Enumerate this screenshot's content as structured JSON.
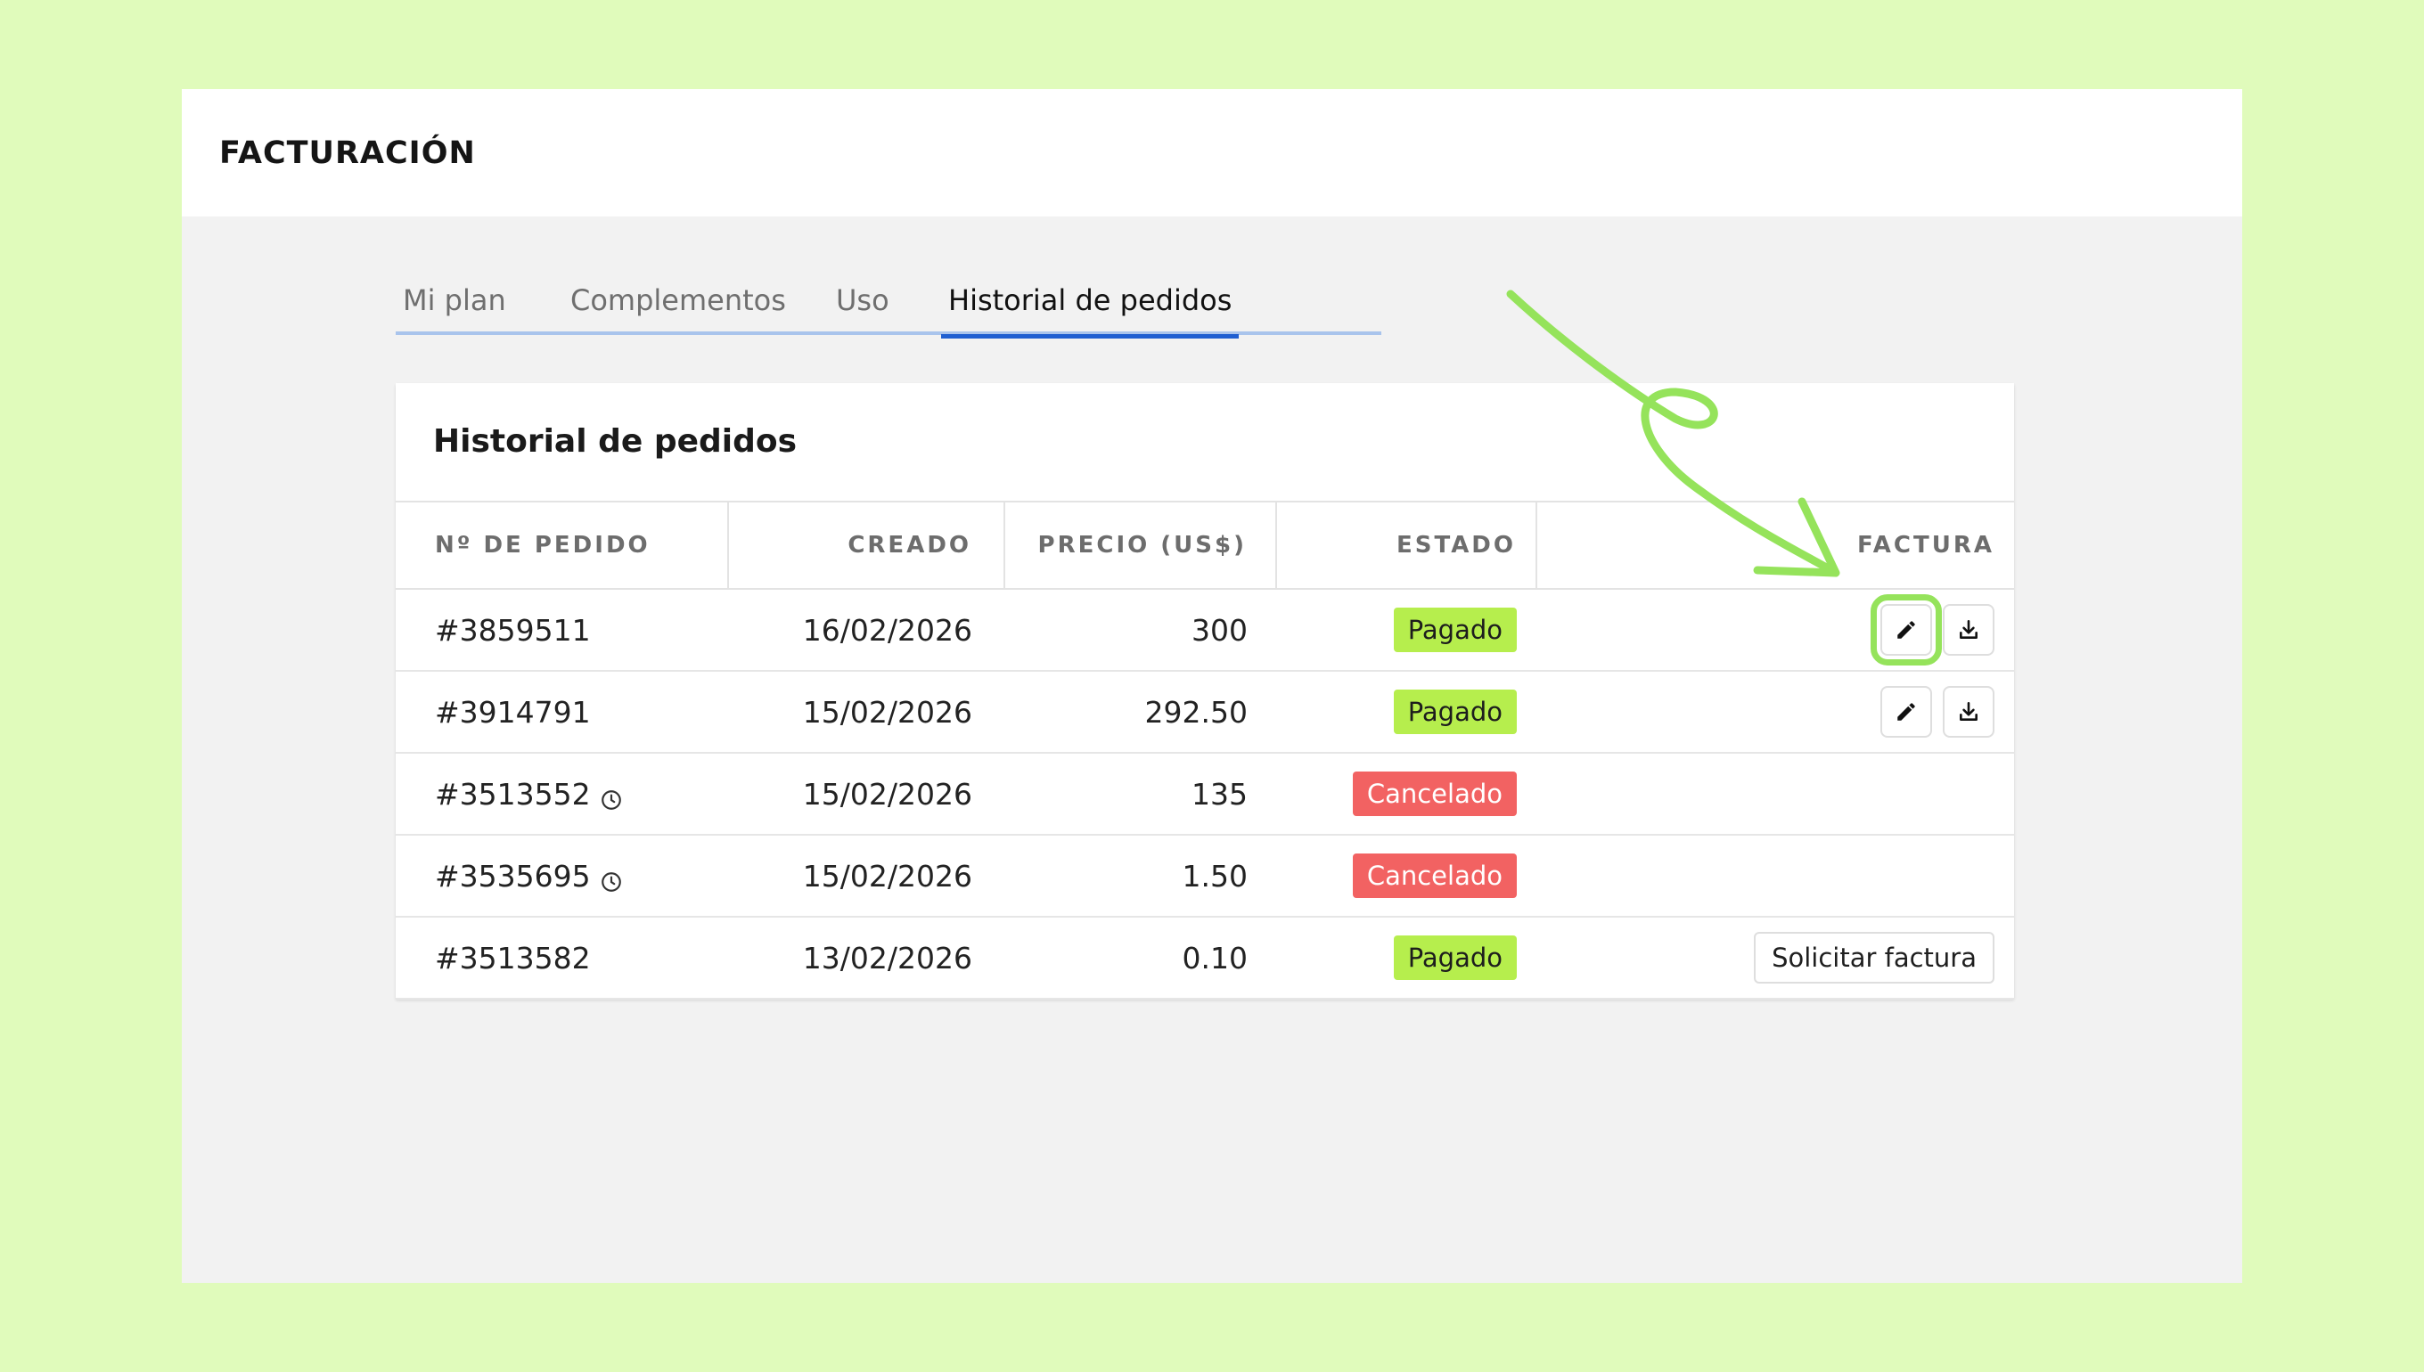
{
  "app": {
    "title": "FACTURACIÓN"
  },
  "tabs": [
    {
      "label": "Mi plan"
    },
    {
      "label": "Complementos"
    },
    {
      "label": "Uso"
    },
    {
      "label": "Historial de pedidos",
      "active": true
    }
  ],
  "card": {
    "title": "Historial de pedidos"
  },
  "table": {
    "headers": [
      "Nº DE PEDIDO",
      "CREADO",
      "PRECIO (US$)",
      "ESTADO",
      "FACTURA"
    ],
    "rows": [
      {
        "order": "#3859511",
        "created": "16/02/2026",
        "price": "300",
        "status": "Pagado",
        "status_type": "paid",
        "pending_icon": false,
        "invoice": "icons"
      },
      {
        "order": "#3914791",
        "created": "15/02/2026",
        "price": "292.50",
        "status": "Pagado",
        "status_type": "paid",
        "pending_icon": false,
        "invoice": "icons"
      },
      {
        "order": "#3513552",
        "created": "15/02/2026",
        "price": "135",
        "status": "Cancelado",
        "status_type": "cancelled",
        "pending_icon": true,
        "invoice": "none"
      },
      {
        "order": "#3535695",
        "created": "15/02/2026",
        "price": "1.50",
        "status": "Cancelado",
        "status_type": "cancelled",
        "pending_icon": true,
        "invoice": "none"
      },
      {
        "order": "#3513582",
        "created": "13/02/2026",
        "price": "0.10",
        "status": "Pagado",
        "status_type": "paid",
        "pending_icon": false,
        "invoice": "request"
      }
    ],
    "request_invoice_label": "Solicitar factura"
  },
  "icons": {
    "edit": "pencil-icon",
    "download": "download-icon",
    "pending": "clock-icon"
  },
  "colors": {
    "background": "#e0fbbb",
    "accent_tab": "#1f5fd1",
    "paid": "#b6ee4d",
    "cancelled": "#f26262",
    "annotation": "#95e35b"
  }
}
